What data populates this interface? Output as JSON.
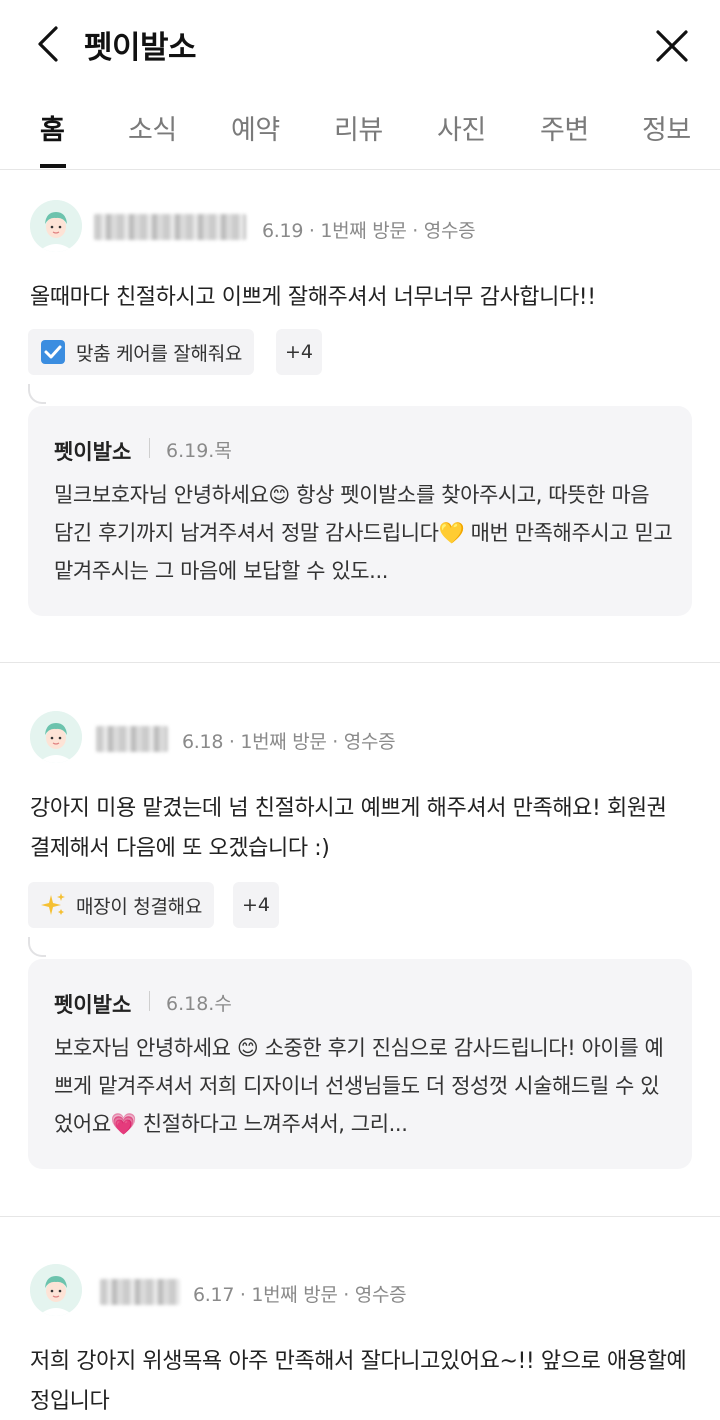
{
  "header": {
    "title": "펫이발소",
    "back_icon": "chevron-left-icon",
    "close_icon": "close-icon"
  },
  "tabs": [
    {
      "label": "홈",
      "active": true
    },
    {
      "label": "소식"
    },
    {
      "label": "예약"
    },
    {
      "label": "리뷰"
    },
    {
      "label": "사진"
    },
    {
      "label": "주변"
    },
    {
      "label": "정보"
    }
  ],
  "reviews": [
    {
      "meta": "6.19 · 1번째 방문 · 영수증",
      "text": "올때마다 친절하시고 이쁘게 잘해주셔서 너무너무 감사합니다!!",
      "tag": {
        "icon": "check-box-icon",
        "label": "맞춤 케어를 잘해줘요"
      },
      "tag_more": "+4",
      "reply": {
        "author": "펫이발소",
        "date": "6.19.목",
        "text": "밀크보호자님 안녕하세요😊 항상 펫이발소를 찾아주시고, 따뜻한 마음 담긴 후기까지 남겨주셔서 정말 감사드립니다💛 매번 만족해주시고 믿고 맡겨주시는 그 마음에 보답할 수 있도..."
      }
    },
    {
      "meta": "6.18 · 1번째 방문 · 영수증",
      "text": "강아지 미용 맡겼는데 넘 친절하시고 예쁘게 해주셔서 만족해요! 회원권 결제해서 다음에 또 오겠습니다 :)",
      "tag": {
        "icon": "sparkles-icon",
        "label": "매장이 청결해요"
      },
      "tag_more": "+4",
      "reply": {
        "author": "펫이발소",
        "date": "6.18.수",
        "text": "보호자님 안녕하세요 😊 소중한 후기 진심으로 감사드립니다! 아이를 예쁘게 맡겨주셔서 저희 디자이너 선생님들도 더 정성껏 시술해드릴 수 있었어요💗 친절하다고 느껴주셔서, 그리..."
      }
    },
    {
      "meta": "6.17 · 1번째 방문 · 영수증",
      "text": "저희 강아지 위생목욕 아주 만족해서 잘다니고있어요~!! 앞으로 애용할예정입니다"
    }
  ]
}
